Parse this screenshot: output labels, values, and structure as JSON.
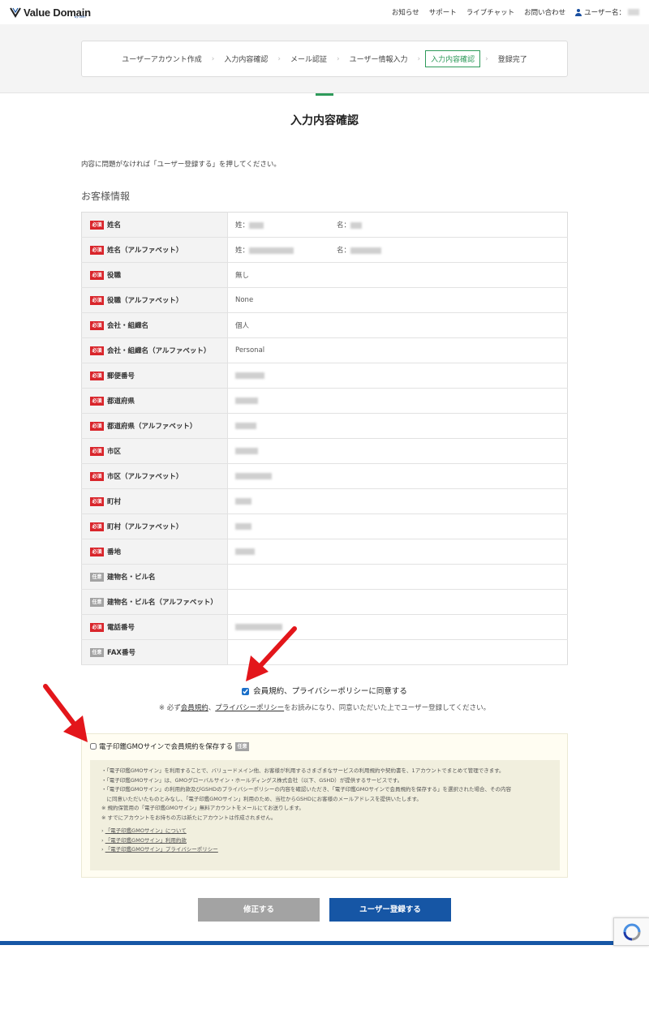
{
  "header": {
    "logo_text": "Value Domain",
    "logo_sub": "by GMO",
    "nav": [
      "お知らせ",
      "サポート",
      "ライブチャット",
      "お問い合わせ"
    ],
    "user_label": "ユーザー名："
  },
  "progress": {
    "steps": [
      "ユーザーアカウント作成",
      "入力内容確認",
      "メール認証",
      "ユーザー情報入力",
      "入力内容確認",
      "登録完了"
    ],
    "active_index": 4,
    "separator": "›"
  },
  "page": {
    "title": "入力内容確認",
    "intro": "内容に問題がなければ「ユーザー登録する」を押してください。",
    "section_title": "お客様情報"
  },
  "badges": {
    "required": "必須",
    "optional": "任意"
  },
  "rows": [
    {
      "label": "姓名",
      "badge": "required",
      "last_prefix": "姓：",
      "first_prefix": "名："
    },
    {
      "label": "姓名（アルファベット）",
      "badge": "required",
      "last_prefix": "姓：",
      "first_prefix": "名："
    },
    {
      "label": "役職",
      "badge": "required",
      "value": "無し"
    },
    {
      "label": "役職（アルファベット）",
      "badge": "required",
      "value": "None"
    },
    {
      "label": "会社・組織名",
      "badge": "required",
      "value": "個人"
    },
    {
      "label": "会社・組織名（アルファベット）",
      "badge": "required",
      "value": "Personal"
    },
    {
      "label": "郵便番号",
      "badge": "required"
    },
    {
      "label": "都道府県",
      "badge": "required"
    },
    {
      "label": "都道府県（アルファベット）",
      "badge": "required"
    },
    {
      "label": "市区",
      "badge": "required"
    },
    {
      "label": "市区（アルファベット）",
      "badge": "required"
    },
    {
      "label": "町村",
      "badge": "required"
    },
    {
      "label": "町村（アルファベット）",
      "badge": "required"
    },
    {
      "label": "番地",
      "badge": "required"
    },
    {
      "label": "建物名・ビル名",
      "badge": "optional"
    },
    {
      "label": "建物名・ビル名（アルファベット）",
      "badge": "optional"
    },
    {
      "label": "電話番号",
      "badge": "required"
    },
    {
      "label": "FAX番号",
      "badge": "optional"
    }
  ],
  "agreement": {
    "label": "会員規約、プライバシーポリシーに同意する",
    "checked": true,
    "note_prefix": "※ 必ず",
    "terms_link": "会員規約",
    "sep": "、",
    "privacy_link": "プライバシーポリシー",
    "note_suffix": "をお読みになり、同意いただいた上でユーザー登録してください。"
  },
  "gmo": {
    "checkbox_label": "電子印鑑GMOサインで会員規約を保存する",
    "checked": false,
    "lines": [
      "・「電子印鑑GMOサイン」を利用することで、バリュードメイン他、お客様が利用するさまざまなサービスの利用規約や契約書を、1アカウントでまとめて管理できます。",
      "・「電子印鑑GMOサイン」は、GMOグローバルサイン・ホールディングス株式会社（以下、GSHD）が提供するサービスです。",
      "・「電子印鑑GMOサイン」の利用約款及びGSHDのプライバシーポリシーの内容を確認いただき、「電子印鑑GMOサインで会員規約を保存する」を選択された場合、その内容",
      "　に同意いただいたものとみなし、「電子印鑑GMOサイン」利用のため、当社からGSHDにお客様のメールアドレスを提供いたします。",
      "※ 規約保管用の「電子印鑑GMOサイン」無料アカウントをメールにてお送りします。",
      "※ すでにアカウントをお持ちの方は新たにアカウントは作成されません。"
    ],
    "links": [
      "「電子印鑑GMOサイン」について",
      "「電子印鑑GMOサイン」利用約款",
      "「電子印鑑GMOサイン」プライバシーポリシー"
    ]
  },
  "buttons": {
    "edit": "修正する",
    "submit": "ユーザー登録する"
  },
  "colors": {
    "brand_blue": "#1656a5",
    "required_red": "#d9252b",
    "active_green": "#2e9a5a",
    "arrow_red": "#e3161b"
  }
}
